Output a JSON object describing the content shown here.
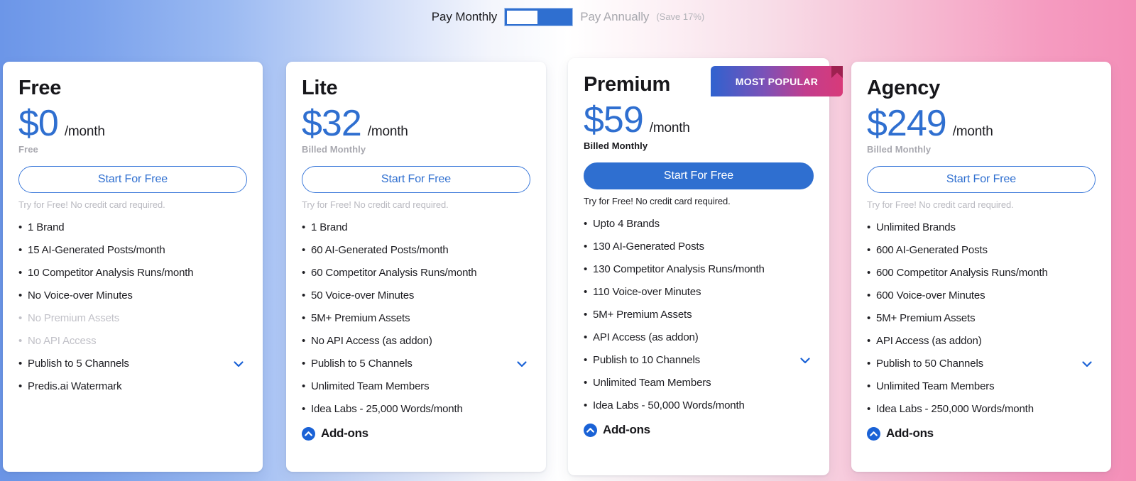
{
  "billing_toggle": {
    "monthly_label": "Pay Monthly",
    "annual_label": "Pay Annually",
    "annual_save_note": "(Save 17%)",
    "selected": "monthly"
  },
  "colors": {
    "accent_blue": "#2f6fd0",
    "addon_blue": "#1a62d6",
    "muted_gray": "#b9b9c0",
    "dim_gray": "#c1c1c8",
    "ribbon_from": "#2f62cf",
    "ribbon_to": "#d83a79",
    "bg_left": "#6c96e8",
    "bg_right": "#f48fb8"
  },
  "badges": {
    "most_popular": "MOST POPULAR"
  },
  "icons": {
    "chevron_down": "chevron-down-icon",
    "chevron_up_circle": "chevron-up-circle-icon"
  },
  "plans": [
    {
      "name": "Free",
      "price": "$0",
      "per": "/month",
      "billed": "Free",
      "cta": "Start For Free",
      "note": "Try for Free! No credit card required.",
      "addons_label": "Add-ons",
      "show_addons": false,
      "features": [
        {
          "text": "1 Brand",
          "dim": false,
          "chevron": false
        },
        {
          "text": "15 AI-Generated Posts/month",
          "dim": false,
          "chevron": false
        },
        {
          "text": "10 Competitor Analysis Runs/month",
          "dim": false,
          "chevron": false
        },
        {
          "text": "No Voice-over Minutes",
          "dim": false,
          "chevron": false
        },
        {
          "text": "No Premium Assets",
          "dim": true,
          "chevron": false
        },
        {
          "text": "No API Access",
          "dim": true,
          "chevron": false
        },
        {
          "text": "Publish to 5 Channels",
          "dim": false,
          "chevron": true
        },
        {
          "text": "Predis.ai Watermark",
          "dim": false,
          "chevron": false
        }
      ]
    },
    {
      "name": "Lite",
      "price": "$32",
      "per": "/month",
      "billed": "Billed Monthly",
      "cta": "Start For Free",
      "note": "Try for Free! No credit card required.",
      "addons_label": "Add-ons",
      "show_addons": true,
      "features": [
        {
          "text": "1 Brand",
          "dim": false,
          "chevron": false
        },
        {
          "text": "60 AI-Generated Posts/month",
          "dim": false,
          "chevron": false
        },
        {
          "text": "60 Competitor Analysis Runs/month",
          "dim": false,
          "chevron": false
        },
        {
          "text": "50 Voice-over Minutes",
          "dim": false,
          "chevron": false
        },
        {
          "text": "5M+ Premium Assets",
          "dim": false,
          "chevron": false
        },
        {
          "text": "No API Access (as addon)",
          "dim": false,
          "chevron": false
        },
        {
          "text": "Publish to 5 Channels",
          "dim": false,
          "chevron": true
        },
        {
          "text": "Unlimited Team Members",
          "dim": false,
          "chevron": false
        },
        {
          "text": "Idea Labs - 25,000 Words/month",
          "dim": false,
          "chevron": false
        }
      ]
    },
    {
      "name": "Premium",
      "price": "$59",
      "per": "/month",
      "billed": "Billed Monthly",
      "cta": "Start For Free",
      "note": "Try for Free! No credit card required.",
      "addons_label": "Add-ons",
      "show_addons": true,
      "features": [
        {
          "text": "Upto 4 Brands",
          "dim": false,
          "chevron": false
        },
        {
          "text": "130 AI-Generated Posts",
          "dim": false,
          "chevron": false
        },
        {
          "text": "130 Competitor Analysis Runs/month",
          "dim": false,
          "chevron": false
        },
        {
          "text": "110 Voice-over Minutes",
          "dim": false,
          "chevron": false
        },
        {
          "text": "5M+ Premium Assets",
          "dim": false,
          "chevron": false
        },
        {
          "text": "API Access (as addon)",
          "dim": false,
          "chevron": false
        },
        {
          "text": "Publish to 10 Channels",
          "dim": false,
          "chevron": true
        },
        {
          "text": "Unlimited Team Members",
          "dim": false,
          "chevron": false
        },
        {
          "text": "Idea Labs - 50,000 Words/month",
          "dim": false,
          "chevron": false
        }
      ]
    },
    {
      "name": "Agency",
      "price": "$249",
      "per": "/month",
      "billed": "Billed Monthly",
      "cta": "Start For Free",
      "note": "Try for Free! No credit card required.",
      "addons_label": "Add-ons",
      "show_addons": true,
      "features": [
        {
          "text": "Unlimited Brands",
          "dim": false,
          "chevron": false
        },
        {
          "text": "600 AI-Generated Posts",
          "dim": false,
          "chevron": false
        },
        {
          "text": "600 Competitor Analysis Runs/month",
          "dim": false,
          "chevron": false
        },
        {
          "text": "600 Voice-over Minutes",
          "dim": false,
          "chevron": false
        },
        {
          "text": "5M+ Premium Assets",
          "dim": false,
          "chevron": false
        },
        {
          "text": "API Access (as addon)",
          "dim": false,
          "chevron": false
        },
        {
          "text": "Publish to 50 Channels",
          "dim": false,
          "chevron": true
        },
        {
          "text": "Unlimited Team Members",
          "dim": false,
          "chevron": false
        },
        {
          "text": "Idea Labs - 250,000 Words/month",
          "dim": false,
          "chevron": false
        }
      ]
    }
  ]
}
